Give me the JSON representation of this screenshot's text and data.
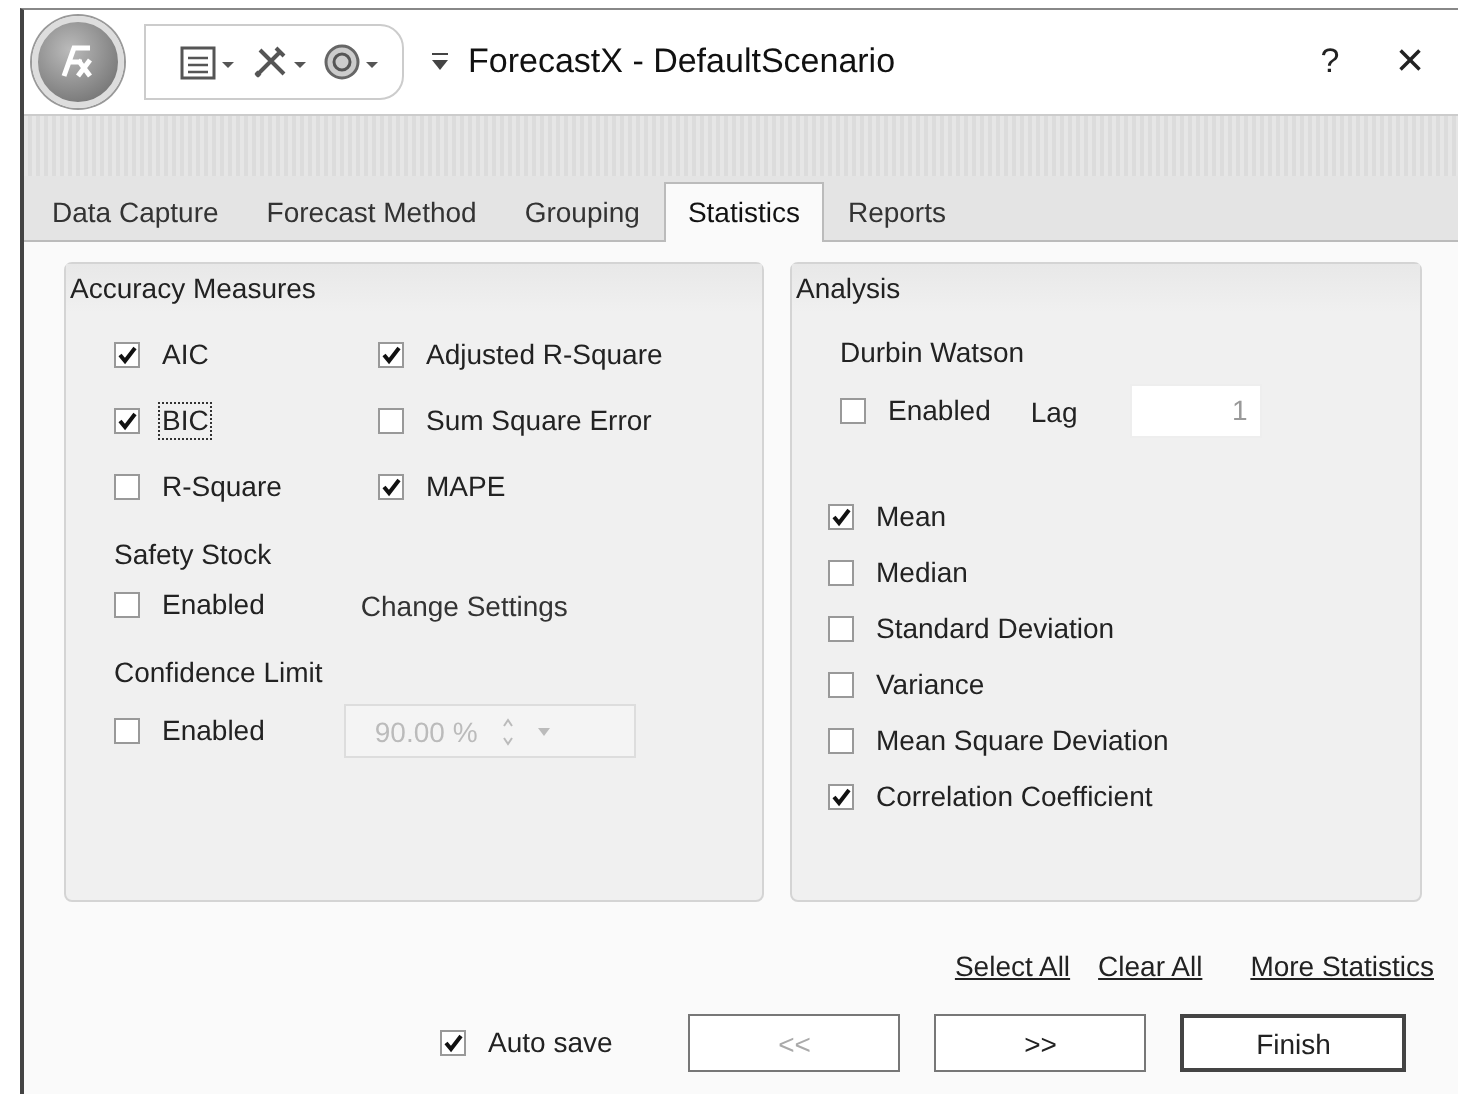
{
  "window": {
    "title": "ForecastX - DefaultScenario",
    "help": "?",
    "close": "×"
  },
  "tabs": [
    {
      "label": "Data Capture",
      "selected": false
    },
    {
      "label": "Forecast Method",
      "selected": false
    },
    {
      "label": "Grouping",
      "selected": false
    },
    {
      "label": "Statistics",
      "selected": true
    },
    {
      "label": "Reports",
      "selected": false
    }
  ],
  "accuracy_measures": {
    "title": "Accuracy Measures",
    "checks": [
      {
        "label": "AIC",
        "checked": true,
        "focused": false
      },
      {
        "label": "Adjusted R-Square",
        "checked": true,
        "focused": false
      },
      {
        "label": "BIC",
        "checked": true,
        "focused": true
      },
      {
        "label": "Sum Square Error",
        "checked": false,
        "focused": false
      },
      {
        "label": "R-Square",
        "checked": false,
        "focused": false
      },
      {
        "label": "MAPE",
        "checked": true,
        "focused": false
      }
    ],
    "safety_stock": {
      "label": "Safety Stock",
      "check": {
        "label": "Enabled",
        "checked": false
      },
      "link": "Change Settings"
    },
    "confidence_limit": {
      "label": "Confidence Limit",
      "check": {
        "label": "Enabled",
        "checked": false
      },
      "spinner": {
        "value": "90.00 %",
        "disabled": true
      }
    }
  },
  "analysis": {
    "title": "Analysis",
    "durbin_watson": {
      "label": "Durbin Watson",
      "check": {
        "label": "Enabled",
        "checked": false
      },
      "lag_label": "Lag",
      "lag_value": "1"
    },
    "checks": [
      {
        "label": "Mean",
        "checked": true
      },
      {
        "label": "Median",
        "checked": false
      },
      {
        "label": "Standard Deviation",
        "checked": false
      },
      {
        "label": "Variance",
        "checked": false
      },
      {
        "label": "Mean Square Deviation",
        "checked": false
      },
      {
        "label": "Correlation Coefficient",
        "checked": true
      }
    ]
  },
  "links": [
    "Select All",
    "Clear All",
    "More Statistics"
  ],
  "auto_save": {
    "label": "Auto save",
    "checked": true
  },
  "buttons": [
    {
      "label": "<<",
      "disabled": true,
      "default": false
    },
    {
      "label": ">>",
      "disabled": false,
      "default": false
    },
    {
      "label": "Finish",
      "disabled": false,
      "default": true
    }
  ]
}
